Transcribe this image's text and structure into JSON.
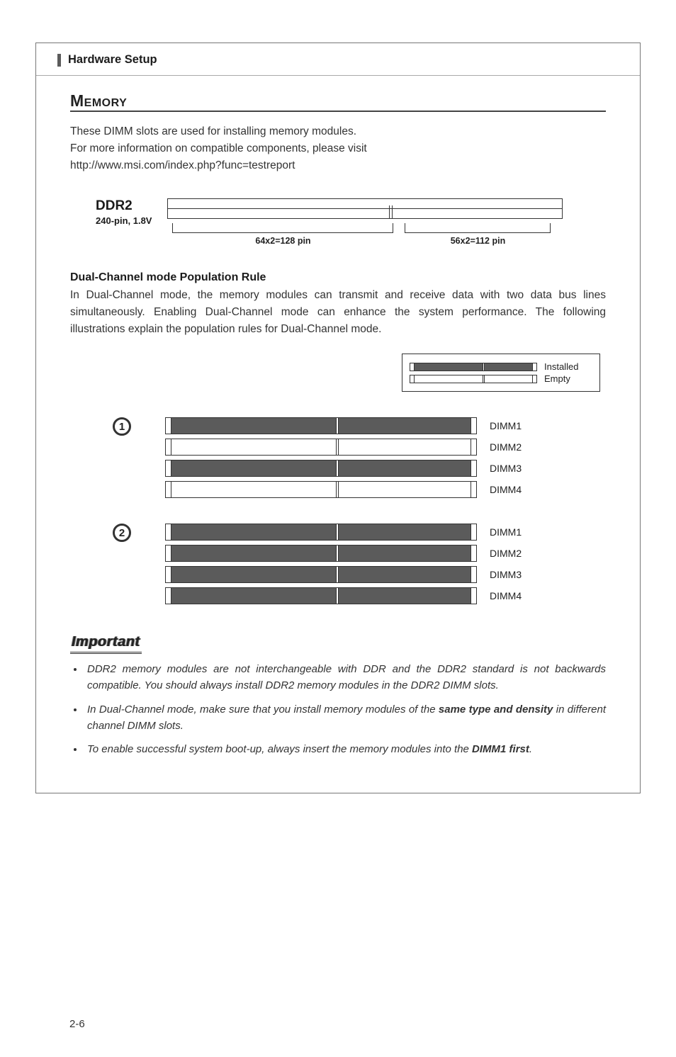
{
  "header": {
    "section": "Hardware Setup"
  },
  "memory": {
    "heading": "Memory",
    "intro_l1": "These DIMM slots are used for installing memory modules.",
    "intro_l2": "For more information on compatible components, please visit",
    "intro_l3": "http://www.msi.com/index.php?func=testreport"
  },
  "ddr": {
    "title": "DDR2",
    "subtitle": "240-pin, 1.8V",
    "dim1": "64x2=128 pin",
    "dim2": "56x2=112  pin"
  },
  "dualchannel": {
    "heading": "Dual-Channel mode Population Rule",
    "body": "In Dual-Channel mode, the memory modules can transmit and receive data with two data bus lines simultaneously. Enabling Dual-Channel mode can enhance the system performance. The following illustrations explain the population rules for Dual-Channel mode."
  },
  "legend": {
    "installed": "Installed",
    "empty": "Empty"
  },
  "configs": [
    {
      "num": "1",
      "slots": [
        {
          "label": "DIMM1",
          "filled": true
        },
        {
          "label": "DIMM2",
          "filled": false
        },
        {
          "label": "DIMM3",
          "filled": true
        },
        {
          "label": "DIMM4",
          "filled": false
        }
      ]
    },
    {
      "num": "2",
      "slots": [
        {
          "label": "DIMM1",
          "filled": true
        },
        {
          "label": "DIMM2",
          "filled": true
        },
        {
          "label": "DIMM3",
          "filled": true
        },
        {
          "label": "DIMM4",
          "filled": true
        }
      ]
    }
  ],
  "important": {
    "heading": "Important",
    "b1a": "DDR2 memory modules are not interchangeable with DDR and the DDR2 standard is not backwards compatible. You should always install DDR2 memory modules in the DDR2 DIMM slots.",
    "b2a": "In Dual-Channel mode, make sure that you install memory modules of the ",
    "b2b": "same type and density",
    "b2c": " in different channel DIMM slots.",
    "b3a": "To enable successful system boot-up, always insert the memory modules into the ",
    "b3b": "DIMM1 first",
    "b3c": "."
  },
  "page_number": "2-6"
}
